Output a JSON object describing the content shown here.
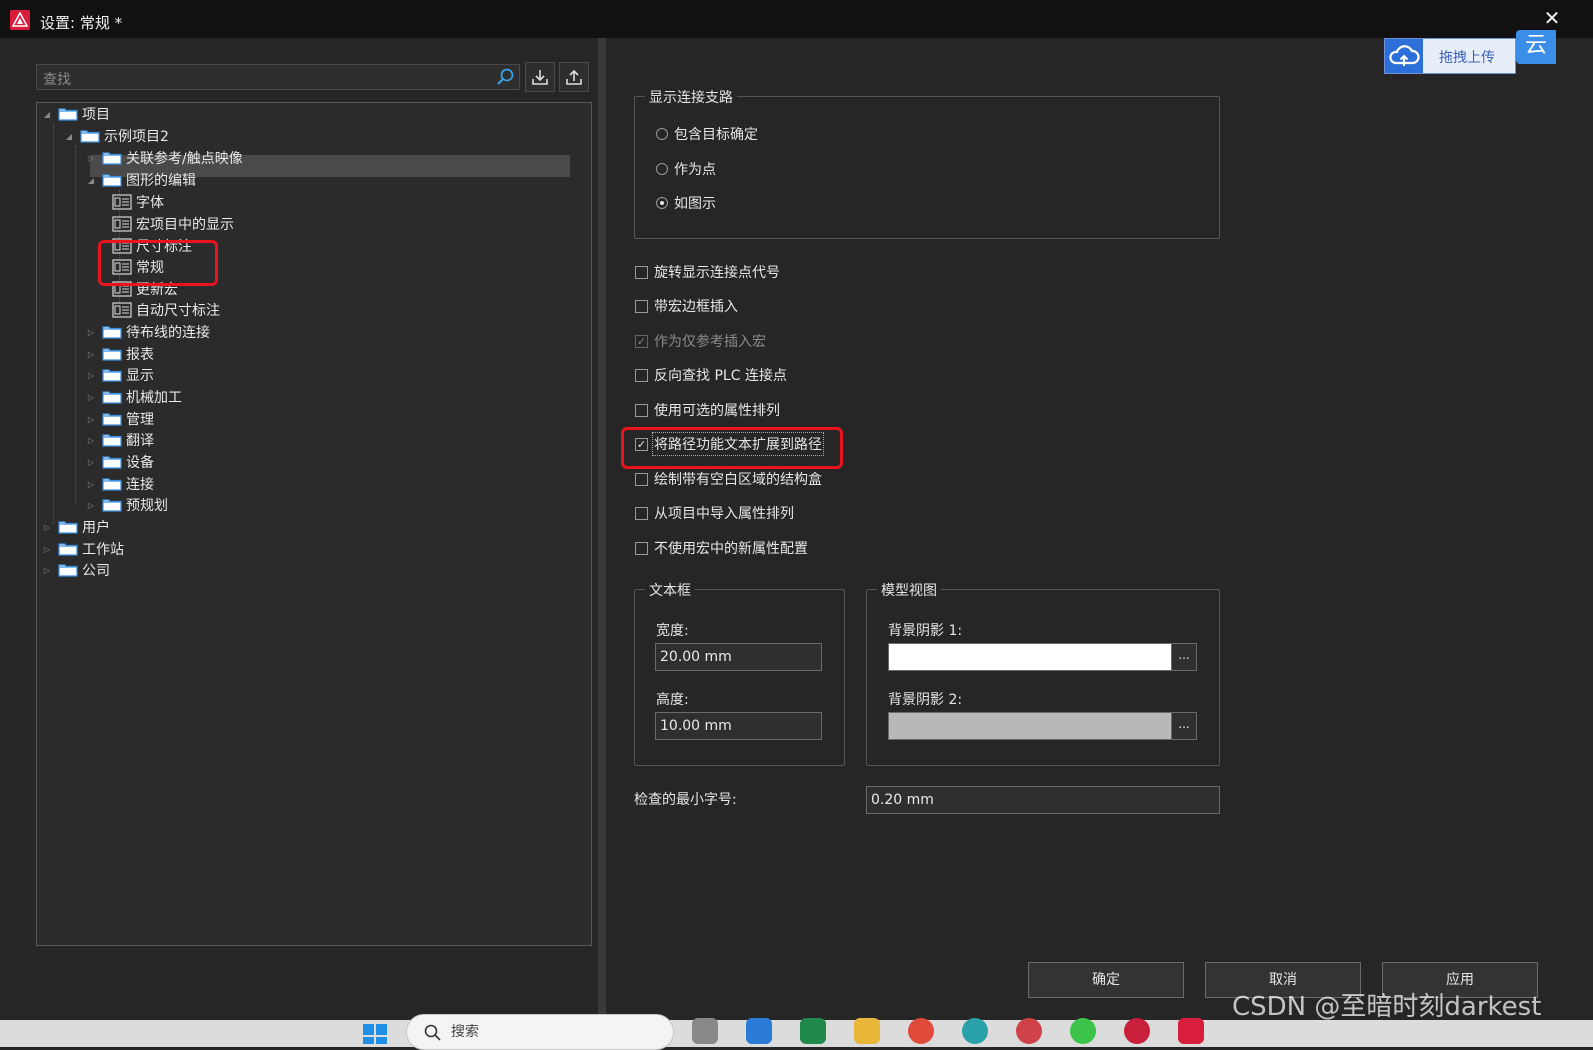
{
  "window": {
    "title": "设置: 常规 *",
    "close_glyph": "✕"
  },
  "search": {
    "placeholder": "查找",
    "icon": "search-icon"
  },
  "toolbar": {
    "import_icon": "import-icon",
    "export_icon": "export-icon"
  },
  "tree": {
    "items": [
      {
        "label": "项目",
        "type": "folder",
        "expanded": true
      },
      {
        "label": "示例项目2",
        "type": "folder",
        "expanded": true
      },
      {
        "label": "关联参考/触点映像",
        "type": "folder",
        "expanded": false
      },
      {
        "label": "图形的编辑",
        "type": "folder",
        "expanded": true
      },
      {
        "label": "字体",
        "type": "page"
      },
      {
        "label": "宏项目中的显示",
        "type": "page"
      },
      {
        "label": "尺寸标注",
        "type": "page"
      },
      {
        "label": "常规",
        "type": "page",
        "selected": true
      },
      {
        "label": "更新宏",
        "type": "page"
      },
      {
        "label": "自动尺寸标注",
        "type": "page"
      },
      {
        "label": "待布线的连接",
        "type": "folder",
        "expanded": false
      },
      {
        "label": "报表",
        "type": "folder",
        "expanded": false
      },
      {
        "label": "显示",
        "type": "folder",
        "expanded": false
      },
      {
        "label": "机械加工",
        "type": "folder",
        "expanded": false
      },
      {
        "label": "管理",
        "type": "folder",
        "expanded": false
      },
      {
        "label": "翻译",
        "type": "folder",
        "expanded": false
      },
      {
        "label": "设备",
        "type": "folder",
        "expanded": false
      },
      {
        "label": "连接",
        "type": "folder",
        "expanded": false
      },
      {
        "label": "预规划",
        "type": "folder",
        "expanded": false
      },
      {
        "label": "用户",
        "type": "folder",
        "expanded": false
      },
      {
        "label": "工作站",
        "type": "folder",
        "expanded": false
      },
      {
        "label": "公司",
        "type": "folder",
        "expanded": false
      }
    ]
  },
  "connection_group": {
    "title": "显示连接支路",
    "options": [
      {
        "label": "包含目标确定",
        "selected": false
      },
      {
        "label": "作为点",
        "selected": false
      },
      {
        "label": "如图示",
        "selected": true
      }
    ]
  },
  "checkboxes": [
    {
      "label": "旋转显示连接点代号",
      "checked": false,
      "disabled": false
    },
    {
      "label": "带宏边框插入",
      "checked": false,
      "disabled": false
    },
    {
      "label": "作为仅参考插入宏",
      "checked": true,
      "disabled": true
    },
    {
      "label": "反向查找 PLC 连接点",
      "checked": false,
      "disabled": false
    },
    {
      "label": "使用可选的属性排列",
      "checked": false,
      "disabled": false
    },
    {
      "label": "将路径功能文本扩展到路径",
      "checked": true,
      "disabled": false
    },
    {
      "label": "绘制带有空白区域的结构盒",
      "checked": false,
      "disabled": false
    },
    {
      "label": "从项目中导入属性排列",
      "checked": false,
      "disabled": false
    },
    {
      "label": "不使用宏中的新属性配置",
      "checked": false,
      "disabled": false
    }
  ],
  "textbox_group": {
    "title": "文本框",
    "width_label": "宽度:",
    "width_value": "20.00 mm",
    "height_label": "高度:",
    "height_value": "10.00 mm"
  },
  "model_view_group": {
    "title": "模型视图",
    "shade1_label": "背景阴影 1:",
    "shade1_color": "#ffffff",
    "shade2_label": "背景阴影 2:",
    "shade2_color": "#b8b8b8",
    "ellipsis": "..."
  },
  "min_font": {
    "label": "检查的最小字号:",
    "value": "0.20 mm"
  },
  "buttons": {
    "ok": "确定",
    "cancel": "取消",
    "apply": "应用"
  },
  "upload_widget": {
    "label": "拖拽上传",
    "badge": "云"
  },
  "taskbar": {
    "search_text": "搜索"
  },
  "watermark": "CSDN @至暗时刻darkest",
  "colors": {
    "accent_red": "#e8141e",
    "brand": "#d81e3c"
  }
}
